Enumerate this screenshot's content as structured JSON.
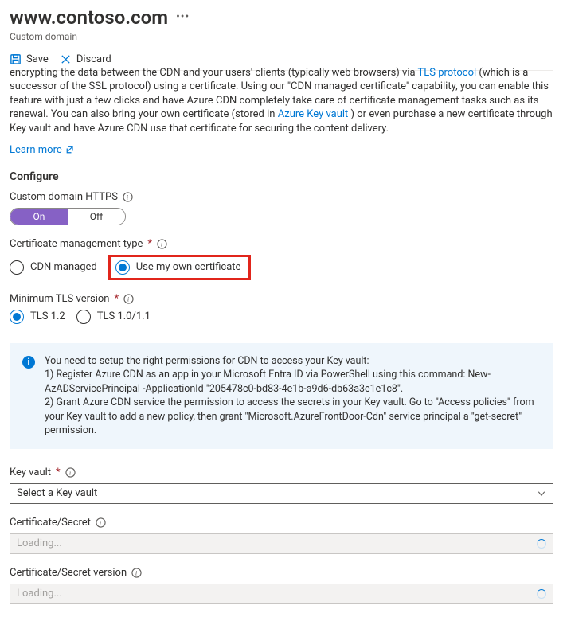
{
  "header": {
    "title": "www.contoso.com",
    "subtitle": "Custom domain"
  },
  "toolbar": {
    "save": "Save",
    "discard": "Discard"
  },
  "desc": {
    "part1_cut": "encrypting the data between the CDN and your users' clients (typically web browsers) via ",
    "link1": "TLS protocol",
    "part2": " (which is a successor of the SSL protocol) using a certificate. Using our \"CDN managed certificate\" capability, you can enable this feature with just a few clicks and have Azure CDN completely take care of certificate management tasks such as its renewal. You can also bring your own certificate (stored in ",
    "link2": "Azure Key vault",
    "part3": " ) or even purchase a new certificate through Key vault and have Azure CDN use that certificate for securing the content delivery.",
    "learn_more": "Learn more"
  },
  "configure": {
    "heading": "Configure",
    "https_label": "Custom domain HTTPS",
    "toggle_on": "On",
    "toggle_off": "Off",
    "cert_mgmt_label": "Certificate management type",
    "cert_opt_cdn": "CDN managed",
    "cert_opt_own": "Use my own certificate",
    "tls_label": "Minimum TLS version",
    "tls_opt_12": "TLS 1.2",
    "tls_opt_10": "TLS 1.0/1.1"
  },
  "info_panel": {
    "line0": "You need to setup the right permissions for CDN to access your Key vault:",
    "line1": "1) Register Azure CDN as an app in your Microsoft Entra ID via PowerShell using this command: New-AzADServicePrincipal -ApplicationId \"205478c0-bd83-4e1b-a9d6-db63a3e1e1c8\".",
    "line2": "2) Grant Azure CDN service the permission to access the secrets in your Key vault. Go to \"Access policies\" from your Key vault to add a new policy, then grant \"Microsoft.AzureFrontDoor-Cdn\" service principal a \"get-secret\" permission."
  },
  "fields": {
    "key_vault_label": "Key vault",
    "key_vault_placeholder": "Select a Key vault",
    "cert_secret_label": "Certificate/Secret",
    "cert_secret_value": "Loading...",
    "cert_secret_ver_label": "Certificate/Secret version",
    "cert_secret_ver_value": "Loading..."
  }
}
